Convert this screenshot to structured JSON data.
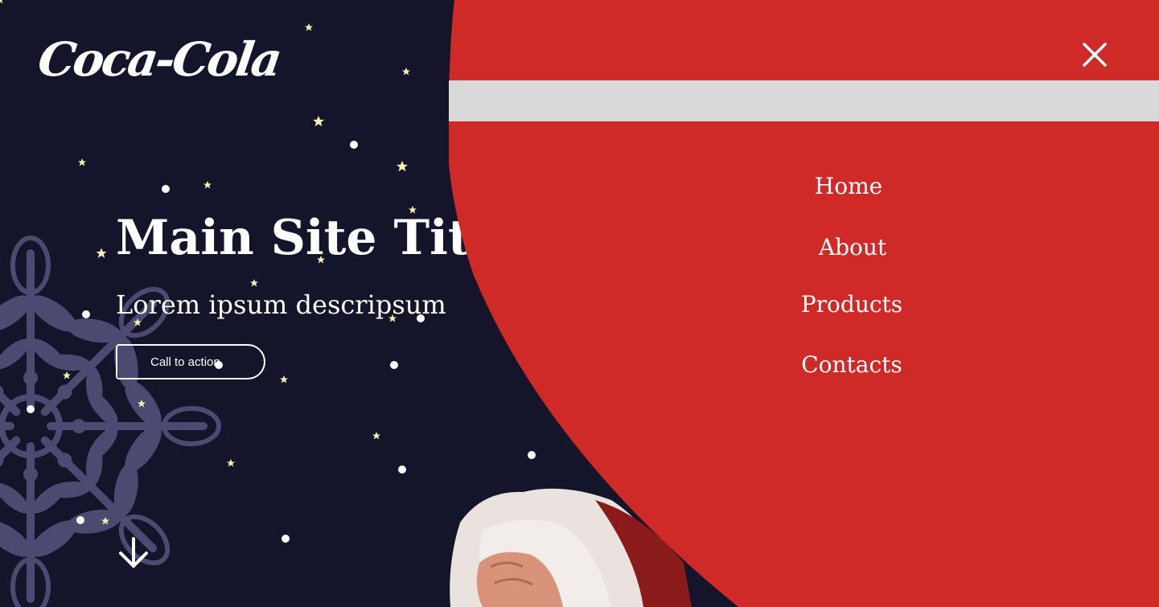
{
  "logo": {
    "text": "Coca-Cola"
  },
  "hero": {
    "title": "Main Site Title",
    "description": "Lorem ipsum descripsum",
    "cta_label": "Call to action"
  },
  "icons": {
    "close": "close-icon",
    "scroll_down": "arrow-down-icon",
    "snowflake": "snowflake-decoration",
    "stars": "star-icon",
    "santa": "santa-hand-image"
  },
  "menu": {
    "items": [
      {
        "label": "Home"
      },
      {
        "label": "About"
      },
      {
        "label": "Products"
      },
      {
        "label": "Contacts"
      }
    ]
  },
  "colors": {
    "background": "#14152a",
    "menu_red": "#cf2a28",
    "menu_bar": "#d9d9d9",
    "star": "#f4f0b0",
    "snowflake": "#4b4b72",
    "text": "#ffffff"
  }
}
